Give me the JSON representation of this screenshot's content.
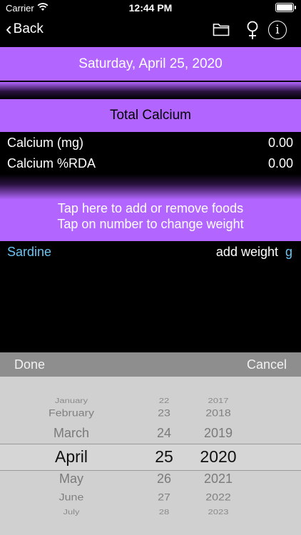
{
  "status": {
    "carrier": "Carrier",
    "time": "12:44 PM"
  },
  "nav": {
    "back_label": "Back",
    "icons": [
      "folder-icon",
      "venus-icon",
      "info-icon"
    ]
  },
  "date_bar": {
    "text": "Saturday, April 25, 2020"
  },
  "total": {
    "title": "Total Calcium"
  },
  "rows": [
    {
      "label": "Calcium (mg)",
      "value": "0.00"
    },
    {
      "label": "Calcium %RDA",
      "value": "0.00"
    }
  ],
  "tap_area": {
    "line1": "Tap here to add or remove foods",
    "line2": "Tap on number to change weight"
  },
  "food": {
    "name": "Sardine",
    "weight_label": "add weight",
    "unit": "g"
  },
  "picker": {
    "done_label": "Done",
    "cancel_label": "Cancel",
    "months": [
      "January",
      "February",
      "March",
      "April",
      "May",
      "June",
      "July"
    ],
    "days": [
      "22",
      "23",
      "24",
      "25",
      "26",
      "27",
      "28"
    ],
    "years": [
      "2017",
      "2018",
      "2019",
      "2020",
      "2021",
      "2022",
      "2023"
    ],
    "selected": {
      "month": "April",
      "day": "25",
      "year": "2020"
    }
  },
  "colors": {
    "purple": "#b266ff",
    "link_blue": "#6ac4f4",
    "picker_bg": "#d0d0d0",
    "toolbar_bg": "#8e8e8e"
  }
}
